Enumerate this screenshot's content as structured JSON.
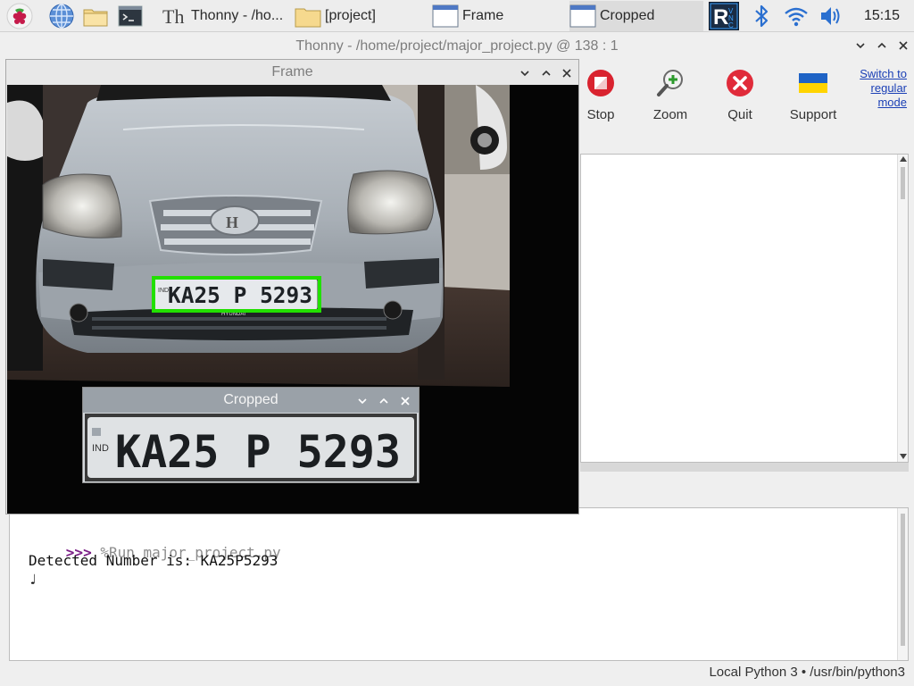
{
  "taskbar": {
    "tasks": [
      {
        "label": "Thonny  -  /ho...",
        "icon": "thonny-icon"
      },
      {
        "label": "[project]",
        "icon": "folder-icon"
      },
      {
        "label": "Frame",
        "icon": "window-icon"
      },
      {
        "label": "Cropped",
        "icon": "window-icon"
      }
    ],
    "tray": [
      "vnc-icon",
      "bluetooth-icon",
      "wifi-icon",
      "volume-icon"
    ],
    "clock": "15:15"
  },
  "thonny": {
    "title": "Thonny  -  /home/project/major_project.py  @  138 : 1",
    "toolbar": {
      "stop_label": "Stop",
      "zoom_label": "Zoom",
      "quit_label": "Quit",
      "support_label": "Support",
      "switch_line1": "Switch to",
      "switch_line2": "regular",
      "switch_line3": "mode"
    },
    "shell": {
      "prompt": ">>>",
      "command": " %Run major_project.py",
      "output": "Detected Number is: KA25P5293",
      "note_glyph": "♩"
    },
    "status": "Local Python 3  •  /usr/bin/python3"
  },
  "frame_window": {
    "title": "Frame",
    "plate_text": "KA25 P 5293",
    "plate_prefix": "IND",
    "badge_text": "HYUNDAI"
  },
  "cropped_window": {
    "title": "Cropped",
    "plate_text": "KA25 P 5293",
    "plate_prefix": "IND"
  },
  "colors": {
    "detection_box": "#22e000",
    "prompt": "#7a1f86",
    "shell_command": "#8c8c8c",
    "link": "#1a3fb5"
  }
}
